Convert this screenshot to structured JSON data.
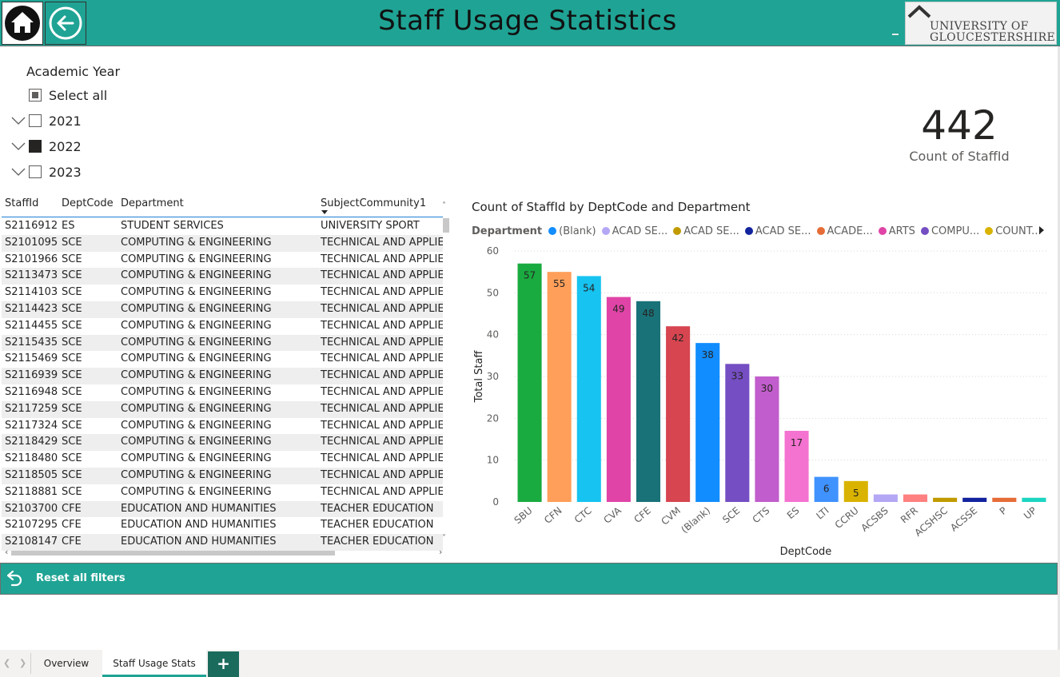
{
  "header": {
    "title": "Staff Usage Statistics",
    "logo_line1": "UNIVERSITY OF",
    "logo_line2": "GLOUCESTERSHIRE"
  },
  "slicer": {
    "title": "Academic Year",
    "items": [
      {
        "label": "Select all",
        "state": "partial"
      },
      {
        "label": "2021",
        "state": "unchecked"
      },
      {
        "label": "2022",
        "state": "checked"
      },
      {
        "label": "2023",
        "state": "unchecked"
      }
    ]
  },
  "kpi": {
    "value": "442",
    "label": "Count of StaffId"
  },
  "table": {
    "columns": [
      "StaffId",
      "DeptCode",
      "Department",
      "SubjectCommunity1"
    ],
    "rows": [
      [
        "S2116912",
        "ES",
        "STUDENT SERVICES",
        "UNIVERSITY SPORT"
      ],
      [
        "S2101095",
        "SCE",
        "COMPUTING & ENGINEERING",
        "TECHNICAL AND APPLIED"
      ],
      [
        "S2101966",
        "SCE",
        "COMPUTING & ENGINEERING",
        "TECHNICAL AND APPLIED"
      ],
      [
        "S2113473",
        "SCE",
        "COMPUTING & ENGINEERING",
        "TECHNICAL AND APPLIED"
      ],
      [
        "S2114103",
        "SCE",
        "COMPUTING & ENGINEERING",
        "TECHNICAL AND APPLIED"
      ],
      [
        "S2114423",
        "SCE",
        "COMPUTING & ENGINEERING",
        "TECHNICAL AND APPLIED"
      ],
      [
        "S2114455",
        "SCE",
        "COMPUTING & ENGINEERING",
        "TECHNICAL AND APPLIED"
      ],
      [
        "S2115435",
        "SCE",
        "COMPUTING & ENGINEERING",
        "TECHNICAL AND APPLIED"
      ],
      [
        "S2115469",
        "SCE",
        "COMPUTING & ENGINEERING",
        "TECHNICAL AND APPLIED"
      ],
      [
        "S2116939",
        "SCE",
        "COMPUTING & ENGINEERING",
        "TECHNICAL AND APPLIED"
      ],
      [
        "S2116948",
        "SCE",
        "COMPUTING & ENGINEERING",
        "TECHNICAL AND APPLIED"
      ],
      [
        "S2117259",
        "SCE",
        "COMPUTING & ENGINEERING",
        "TECHNICAL AND APPLIED"
      ],
      [
        "S2117324",
        "SCE",
        "COMPUTING & ENGINEERING",
        "TECHNICAL AND APPLIED"
      ],
      [
        "S2118429",
        "SCE",
        "COMPUTING & ENGINEERING",
        "TECHNICAL AND APPLIED"
      ],
      [
        "S2118480",
        "SCE",
        "COMPUTING & ENGINEERING",
        "TECHNICAL AND APPLIED"
      ],
      [
        "S2118505",
        "SCE",
        "COMPUTING & ENGINEERING",
        "TECHNICAL AND APPLIED"
      ],
      [
        "S2118881",
        "SCE",
        "COMPUTING & ENGINEERING",
        "TECHNICAL AND APPLIED"
      ],
      [
        "S2103700",
        "CFE",
        "EDUCATION AND HUMANITIES",
        "TEACHER EDUCATION"
      ],
      [
        "S2107295",
        "CFE",
        "EDUCATION AND HUMANITIES",
        "TEACHER EDUCATION"
      ],
      [
        "S2108147",
        "CFE",
        "EDUCATION AND HUMANITIES",
        "TEACHER EDUCATION"
      ]
    ]
  },
  "chart_data": {
    "type": "bar",
    "title": "Count of StaffId by DeptCode and Department",
    "xlabel": "DeptCode",
    "ylabel": "Total Staff",
    "ylim": [
      0,
      60
    ],
    "yticks": [
      "0",
      "10",
      "20",
      "30",
      "40",
      "50",
      "60"
    ],
    "grid": true,
    "legend_placement": "top",
    "legend_title": "Department",
    "legend": [
      {
        "label": "(Blank)",
        "color": "#118dff"
      },
      {
        "label": "ACAD SE...",
        "color": "#b4a7f5"
      },
      {
        "label": "ACAD SE...",
        "color": "#c19a00"
      },
      {
        "label": "ACAD SE...",
        "color": "#12239e"
      },
      {
        "label": "ACADE...",
        "color": "#e66c37"
      },
      {
        "label": "ARTS",
        "color": "#e044a7"
      },
      {
        "label": "COMPU...",
        "color": "#744ec2"
      },
      {
        "label": "COUNT...",
        "color": "#d9b300"
      }
    ],
    "categories": [
      "SBU",
      "CFN",
      "CTC",
      "CVA",
      "CFE",
      "CVM",
      "(Blank)",
      "SCE",
      "CTS",
      "ES",
      "LTI",
      "CCRU",
      "ACSBS",
      "RFR",
      "ACSHSC",
      "ACSSE",
      "P",
      "UP"
    ],
    "values": [
      57,
      55,
      54,
      49,
      48,
      42,
      38,
      33,
      30,
      17,
      6,
      5,
      1.8,
      1.8,
      1,
      1,
      1,
      1
    ],
    "data_labels": [
      "57",
      "55",
      "54",
      "49",
      "48",
      "42",
      "38",
      "33",
      "30",
      "17",
      "6",
      "5",
      "",
      "",
      "",
      "",
      "",
      ""
    ],
    "colors": [
      "#1aab40",
      "#ff9f5a",
      "#17c3f0",
      "#e044a7",
      "#197278",
      "#d64550",
      "#118dff",
      "#744ec2",
      "#c15dcc",
      "#f472d0",
      "#4092ff",
      "#d9b300",
      "#b4a7f5",
      "#ff8080",
      "#c19a00",
      "#12239e",
      "#e66c37",
      "#1bd5c1"
    ]
  },
  "footer": {
    "reset_label": "Reset all filters"
  },
  "tabs": {
    "items": [
      "Overview",
      "Staff Usage Stats"
    ],
    "active": "Staff Usage Stats",
    "add_label": "+"
  }
}
